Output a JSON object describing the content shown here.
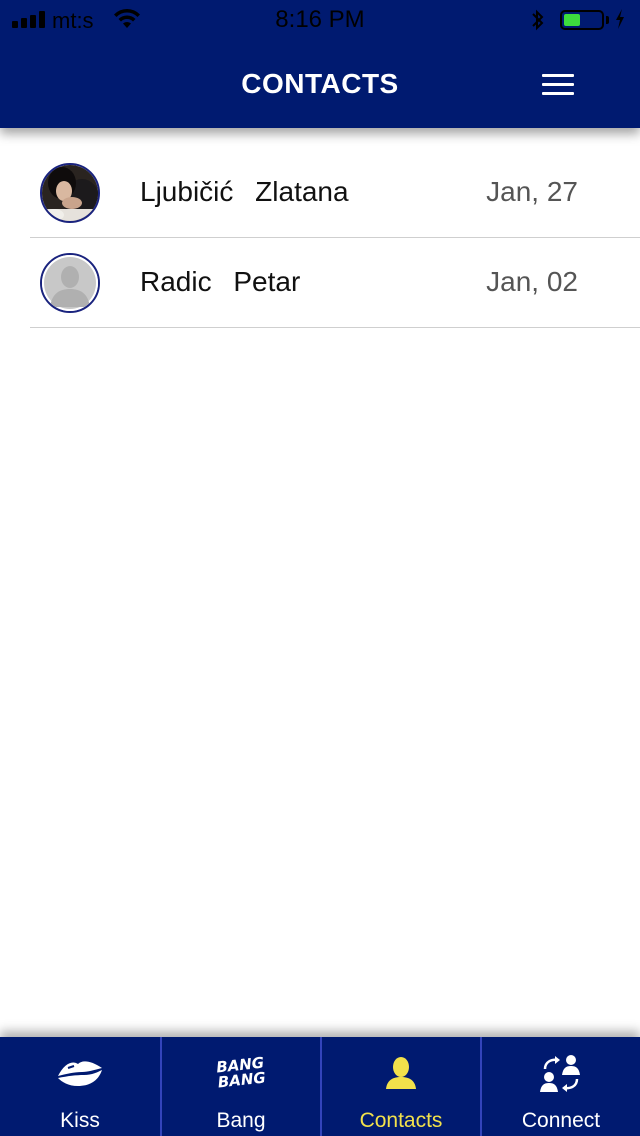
{
  "status_bar": {
    "carrier": "mt:s",
    "time": "8:16 PM",
    "battery_fraction": 0.45,
    "battery_color": "#3ddc3d"
  },
  "header": {
    "title": "CONTACTS",
    "menu_icon": "hamburger-menu-icon",
    "background": "#001a70"
  },
  "contacts": [
    {
      "first": "Ljubičić",
      "last": "Zlatana",
      "date": "Jan, 27",
      "avatar": "photo"
    },
    {
      "first": "Radic",
      "last": "Petar",
      "date": "Jan, 02",
      "avatar": "placeholder-silhouette"
    }
  ],
  "tabs": [
    {
      "label": "Kiss",
      "icon": "lips-icon",
      "active": false
    },
    {
      "label": "Bang",
      "icon": "bang-bang-icon",
      "icon_text": "BANG BANG",
      "active": false
    },
    {
      "label": "Contacts",
      "icon": "person-icon",
      "active": true
    },
    {
      "label": "Connect",
      "icon": "connect-users-icon",
      "active": false
    }
  ],
  "colors": {
    "active_tab": "#f2e14b",
    "tabbar": "#001a70"
  }
}
